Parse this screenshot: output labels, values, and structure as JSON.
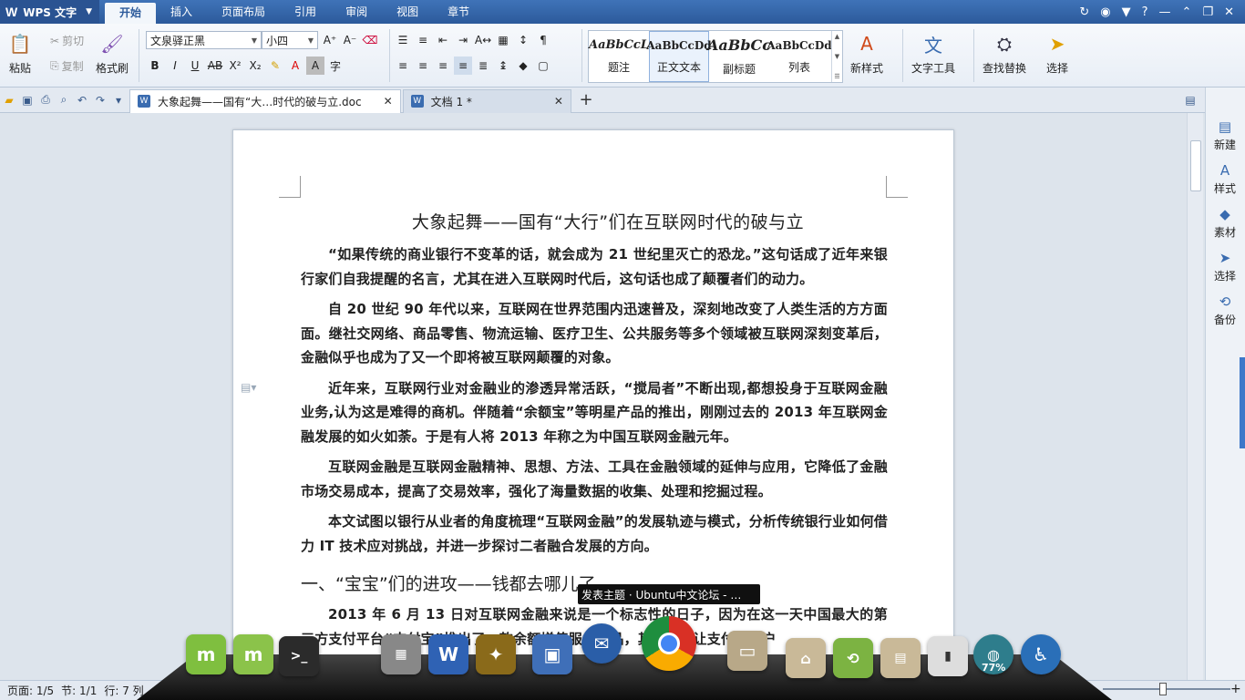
{
  "app": {
    "name": "WPS 文字",
    "logo": "W"
  },
  "menu": {
    "items": [
      "开始",
      "插入",
      "页面布局",
      "引用",
      "审阅",
      "视图",
      "章节"
    ],
    "active": "开始"
  },
  "ribbon": {
    "paste": "粘贴",
    "cut": "剪切",
    "copy": "复制",
    "format_painter": "格式刷",
    "font_name": "文泉驿正黑",
    "font_size": "小四",
    "styles": [
      {
        "sample": "AaBbCcL",
        "label": "题注"
      },
      {
        "sample": "AaBbCcDd",
        "label": "正文文本"
      },
      {
        "sample": "AaBbCc",
        "label": "副标题"
      },
      {
        "sample": "AaBbCcDd",
        "label": "列表"
      }
    ],
    "new_style": "新样式",
    "text_tools": "文字工具",
    "find_replace": "查找替换",
    "select": "选择"
  },
  "tabs": [
    {
      "title": "大象起舞——国有“大…时代的破与立.doc",
      "active": true
    },
    {
      "title": "文档 1 *",
      "active": false
    }
  ],
  "right_panel": [
    "新建",
    "样式",
    "素材",
    "选择",
    "备份"
  ],
  "document": {
    "title": "大象起舞——国有“大行”们在互联网时代的破与立",
    "paragraphs": [
      "“如果传统的商业银行不变革的话，就会成为 21 世纪里灭亡的恐龙。”这句话成了近年来银行家们自我提醒的名言，尤其在进入互联网时代后，这句话也成了颠覆者们的动力。",
      "自 20 世纪 90 年代以来，互联网在世界范围内迅速普及，深刻地改变了人类生活的方方面面。继社交网络、商品零售、物流运输、医疗卫生、公共服务等多个领域被互联网深刻变革后，金融似乎也成为了又一个即将被互联网颠覆的对象。",
      "近年来，互联网行业对金融业的渗透异常活跃，“搅局者”不断出现,都想投身于互联网金融业务,认为这是难得的商机。伴随着“余额宝”等明星产品的推出，刚刚过去的 2013 年互联网金融发展的如火如荼。于是有人将 2013 年称之为中国互联网金融元年。",
      "互联网金融是互联网金融精神、思想、方法、工具在金融领域的延伸与应用，它降低了金融市场交易成本，提高了交易效率，强化了海量数据的收集、处理和挖掘过程。",
      "本文试图以银行从业者的角度梳理“互联网金融”的发展轨迹与模式，分析传统银行业如何借力 IT 技术应对挑战，并进一步探讨二者融合发展的方向。"
    ],
    "heading": "一、“宝宝”们的进攻——钱都去哪儿了",
    "last_paragraph": "2013 年 6 月 13 日对互联网金融来说是一个标志性的日子，因为在这一天中国最大的第三方支付平台“支付宝”推出了一款余额增值服务产品，其作用是让支付宝账户"
  },
  "status": {
    "page": "页面: 1/5",
    "section": "节: 1/1",
    "line": "行: 7  列"
  },
  "dock": {
    "tooltip": "发表主题 · Ubuntu中文论坛 - …",
    "battery": "77%",
    "icons": [
      "mint-menu-icon",
      "mint-update-icon",
      "terminal-icon",
      "calculator-icon",
      "wps-writer-icon",
      "photo-app-icon",
      "virtualbox-icon",
      "thunderbird-icon",
      "chrome-icon",
      "folder-icon",
      "home-folder-icon",
      "backup-icon",
      "documents-folder-icon",
      "usb-icon",
      "network-globe-icon",
      "accessibility-icon"
    ]
  }
}
